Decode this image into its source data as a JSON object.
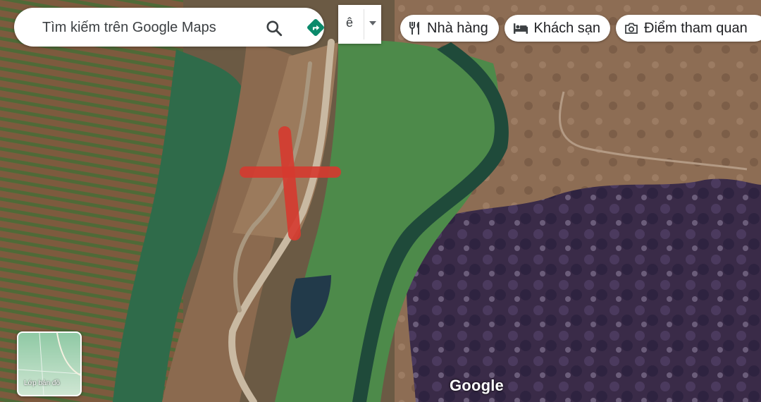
{
  "search": {
    "text": "Tìm kiếm trên Google Maps"
  },
  "layer": {
    "letter": "ê"
  },
  "chips": [
    {
      "label": "Nhà hàng",
      "icon": "restaurant-icon"
    },
    {
      "label": "Khách sạn",
      "icon": "hotel-icon"
    },
    {
      "label": "Điểm tham quan",
      "icon": "camera-icon"
    }
  ],
  "minimap": {
    "label": "Lớp bản đồ"
  },
  "logo": "Google",
  "colors": {
    "marker": "#d63a2f",
    "accent": "#1a73e8",
    "direction": "#0b8a6b"
  }
}
